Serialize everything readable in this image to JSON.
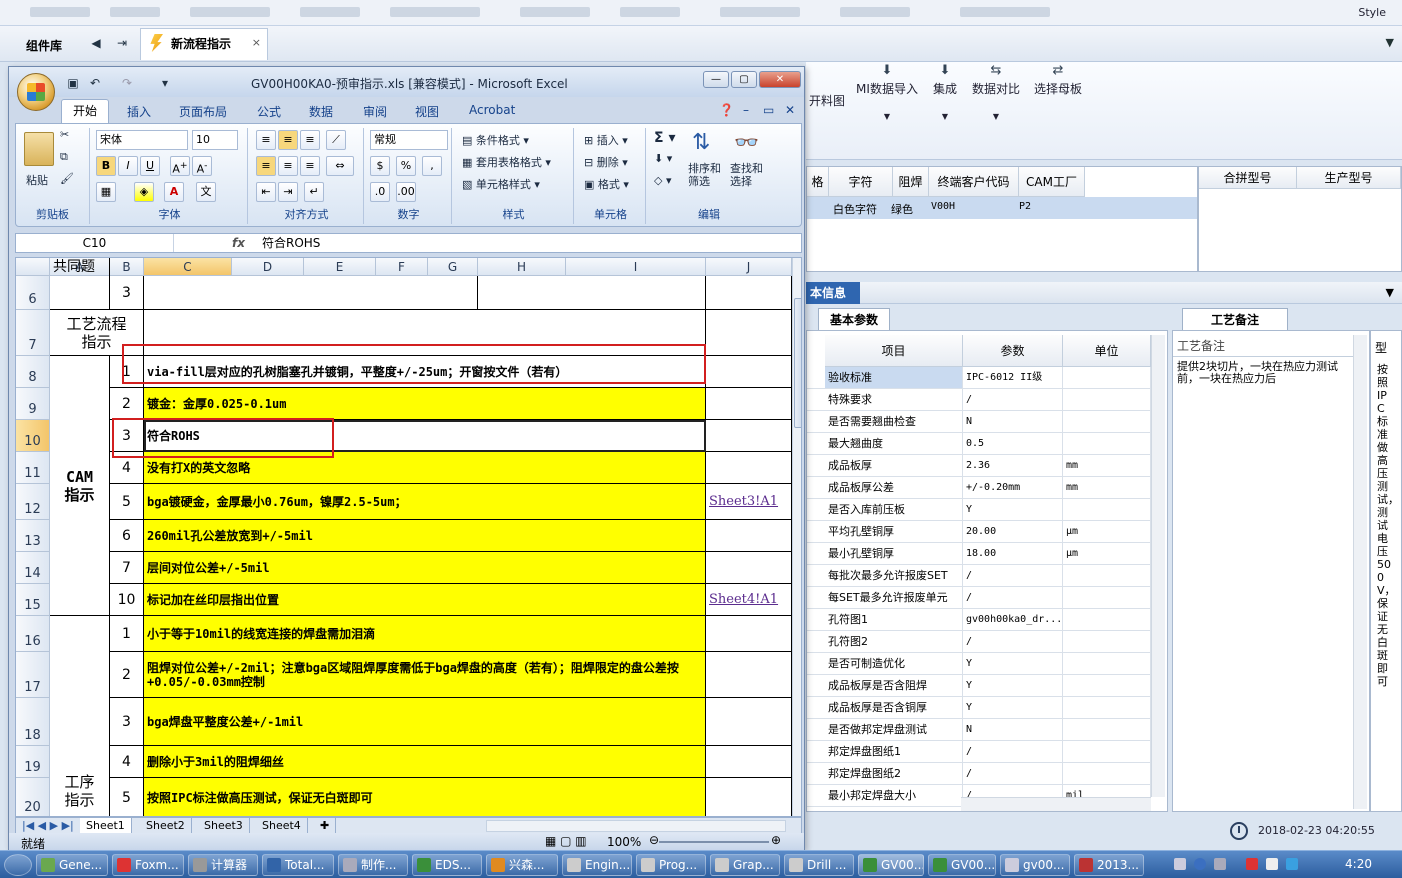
{
  "top": {
    "style_label": "Style"
  },
  "panel": {
    "library_label": "组件库",
    "doc_tab": "新流程指示",
    "close": "×"
  },
  "ribbon2": {
    "items": [
      {
        "label": "开料图",
        "icon": ""
      },
      {
        "label": "MI数据导入",
        "icon": "⬇"
      },
      {
        "label": "集成",
        "icon": "⬇"
      },
      {
        "label": "数据对比",
        "icon": "⇆"
      },
      {
        "label": "选择母板",
        "icon": "⇄"
      }
    ]
  },
  "grid2": {
    "headers": [
      "格",
      "字符",
      "阻焊",
      "终端客户代码",
      "CAM工厂"
    ],
    "row": {
      "char": "白色字符",
      "mask": "绿色",
      "customer": "V00H",
      "factory": "P2"
    }
  },
  "grid3": {
    "headers": [
      "合拼型号",
      "生产型号"
    ]
  },
  "info": {
    "title": "本信息",
    "tab_basic": "基本参数",
    "tab_notes": "工艺备注"
  },
  "params": {
    "headers": [
      "项目",
      "参数",
      "单位"
    ],
    "rows": [
      {
        "item": "验收标准",
        "value": "IPC-6012 II级",
        "unit": ""
      },
      {
        "item": "特殊要求",
        "value": "/",
        "unit": ""
      },
      {
        "item": "是否需要翘曲检查",
        "value": "N",
        "unit": ""
      },
      {
        "item": "最大翘曲度",
        "value": "0.5",
        "unit": ""
      },
      {
        "item": "成品板厚",
        "value": "2.36",
        "unit": "mm"
      },
      {
        "item": "成品板厚公差",
        "value": "+/-0.20mm",
        "unit": "mm"
      },
      {
        "item": "是否入库前压板",
        "value": "Y",
        "unit": ""
      },
      {
        "item": "平均孔壁铜厚",
        "value": "20.00",
        "unit": "μm"
      },
      {
        "item": "最小孔壁铜厚",
        "value": "18.00",
        "unit": "μm"
      },
      {
        "item": "每批次最多允许报废SET",
        "value": "/",
        "unit": ""
      },
      {
        "item": "每SET最多允许报废单元",
        "value": "/",
        "unit": ""
      },
      {
        "item": "孔符图1",
        "value": "gv00h00ka0_dr...",
        "unit": ""
      },
      {
        "item": "孔符图2",
        "value": "/",
        "unit": ""
      },
      {
        "item": "是否可制造优化",
        "value": "Y",
        "unit": ""
      },
      {
        "item": "成品板厚是否含阻焊",
        "value": "Y",
        "unit": ""
      },
      {
        "item": "成品板厚是否含铜厚",
        "value": "Y",
        "unit": ""
      },
      {
        "item": "是否做邦定焊盘测试",
        "value": "N",
        "unit": ""
      },
      {
        "item": "邦定焊盘图纸1",
        "value": "/",
        "unit": ""
      },
      {
        "item": "邦定焊盘图纸2",
        "value": "/",
        "unit": ""
      },
      {
        "item": "最小邦定焊盘大小",
        "value": "/",
        "unit": "mil"
      }
    ]
  },
  "notes": {
    "header": "工艺备注",
    "text": "提供2块切片，一块在热应力测试前，一块在热应力后",
    "type_header": "型",
    "type_text": "按照IPC标准做高压测试，测试电压500V，保证无白斑即可"
  },
  "status2": {
    "datetime": "2018-02-23 04:20:55"
  },
  "excel": {
    "caption": "GV00H00KA0-预审指示.xls  [兼容模式] - Microsoft Excel",
    "tabs": [
      "开始",
      "插入",
      "页面布局",
      "公式",
      "数据",
      "审阅",
      "视图",
      "Acrobat"
    ],
    "groups": {
      "clipboard": "剪贴板",
      "font": "字体",
      "align": "对齐方式",
      "number": "数字",
      "styles": "样式",
      "cells": "单元格",
      "editing": "编辑"
    },
    "paste": "粘贴",
    "font_name": "宋体",
    "font_size": "10",
    "number_format": "常规",
    "styles_items": [
      "条件格式",
      "套用表格格式",
      "单元格样式"
    ],
    "cells_items": [
      "插入",
      "删除",
      "格式"
    ],
    "editing_items": [
      "排序和\n筛选",
      "查找和\n选择"
    ],
    "cell_ref": "C10",
    "formula_value": "符合ROHS",
    "columns": [
      "A",
      "B",
      "C",
      "D",
      "E",
      "F",
      "G",
      "H",
      "I",
      "J"
    ],
    "sheet_tabs": [
      "Sheet1",
      "Sheet2",
      "Sheet3",
      "Sheet4"
    ],
    "status": "就绪",
    "zoom": "100%"
  },
  "sheet": {
    "row_labels": [
      "6",
      "7",
      "8",
      "9",
      "10",
      "11",
      "12",
      "13",
      "14",
      "15",
      "16",
      "17",
      "18",
      "19",
      "20"
    ],
    "r5_text": "共同题",
    "r6_num": "3",
    "flow_label": "工艺流程\n指示",
    "cam_label": "CAM\n指示",
    "proc_label": "工序\n指示",
    "cam_rows": [
      {
        "num": "1",
        "text": "via-fill层对应的孔树脂塞孔并镀铜，平整度+/-25um；开窗按文件（若有）",
        "link": ""
      },
      {
        "num": "2",
        "text": "镀金：金厚0.025-0.1um",
        "link": ""
      },
      {
        "num": "3",
        "text": "符合ROHS",
        "link": ""
      },
      {
        "num": "4",
        "text": "没有打X的英文忽略",
        "link": ""
      },
      {
        "num": "5",
        "text": "bga镀硬金，金厚最小0.76um，镍厚2.5-5um；",
        "link": "Sheet3!A1"
      },
      {
        "num": "6",
        "text": "260mil孔公差放宽到+/-5mil",
        "link": ""
      },
      {
        "num": "7",
        "text": "层间对位公差+/-5mil",
        "link": ""
      },
      {
        "num": "10",
        "text": "标记加在丝印层指出位置",
        "link": "Sheet4!A1"
      }
    ],
    "proc_rows": [
      {
        "num": "1",
        "text": "小于等于10mil的线宽连接的焊盘需加泪滴"
      },
      {
        "num": "2",
        "text": "阻焊对位公差+/-2mil；注意bga区域阻焊厚度需低于bga焊盘的高度（若有）；阻焊限定的盘公差按+0.05/-0.03mm控制"
      },
      {
        "num": "3",
        "text": "bga焊盘平整度公差+/-1mil"
      },
      {
        "num": "4",
        "text": "删除小于3mil的阻焊细丝"
      },
      {
        "num": "5",
        "text": "按照IPC标注做高压测试，保证无白斑即可"
      }
    ]
  },
  "taskbar": {
    "items": [
      "Gene...",
      "Foxm...",
      "计算器",
      "Total...",
      "制作...",
      "EDS...",
      "兴森...",
      "Engin...",
      "Prog...",
      "Grap...",
      "Drill ...",
      "GV00...",
      "GV00...",
      "gv00...",
      "2013..."
    ],
    "time": "4:20"
  }
}
